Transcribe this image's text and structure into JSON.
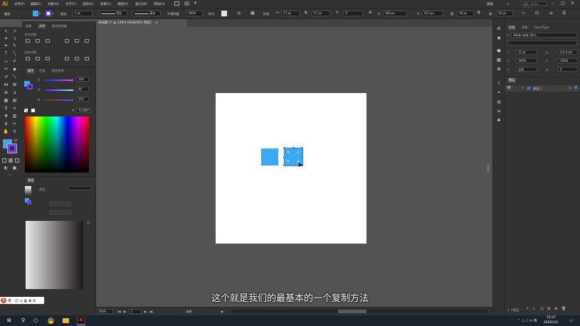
{
  "app": {
    "logo": "Ai",
    "workspace": "基础"
  },
  "menus": [
    "文件(F)",
    "编辑(E)",
    "对象(O)",
    "文字(T)",
    "选择(S)",
    "效果(C)",
    "视图(V)",
    "窗口(W)",
    "帮助(H)"
  ],
  "search_placeholder": "搜索 Adobe Stock",
  "control_bar": {
    "selection_label": "编组",
    "stroke_label": "描边",
    "stroke_weight": "1 pt",
    "stroke_profile": "等比",
    "brush": "基本",
    "opacity_label": "不透明度",
    "opacity": "100%",
    "style_label": "样式",
    "shape_label": "形状",
    "w_value": "57 px",
    "h_value": "57 px",
    "angle": "0°",
    "x_value": "260 px",
    "y_value": "212 px",
    "w2_value": "56 px",
    "h2_value": "56 px"
  },
  "document_tab": "未标题-1* @ 100% (RGB/GPU 预览)",
  "left_panel": {
    "tabs": [
      "变换",
      "对齐",
      "路径查找器"
    ],
    "align_objects_label": "对齐对象:",
    "distribute_label": "分布对象:",
    "color_tabs": [
      "颜色",
      "色板",
      "颜色参考"
    ],
    "r_value": "128",
    "g_value": "60",
    "b_value": "255",
    "hex_value": "7C3DFF",
    "gradient_tab": "渐变",
    "gradient_type": "类型:"
  },
  "right_panel": {
    "char_tabs": [
      "字符",
      "段落",
      "OpenType"
    ],
    "font_name": "Adobe 宋体 Std L",
    "font_size": "12 pt",
    "leading": "(14.4 pt)",
    "scale_h": "100%",
    "scale_v": "100%",
    "kerning": "自动",
    "tracking": "0",
    "layers_tab": "图层",
    "layer_name": "图层 1",
    "layer_count": "1 个图层"
  },
  "status": {
    "zoom": "100%",
    "artboard": "1",
    "tool": "选择"
  },
  "subtitle": "这个就是我们的最基本的一个复制方法",
  "taskbar": {
    "time": "15:47",
    "date": "2020/1/2"
  },
  "colors": {
    "fill": "#3da9f2",
    "stroke": "#7c3dff",
    "accent": "#2a7dd8"
  }
}
